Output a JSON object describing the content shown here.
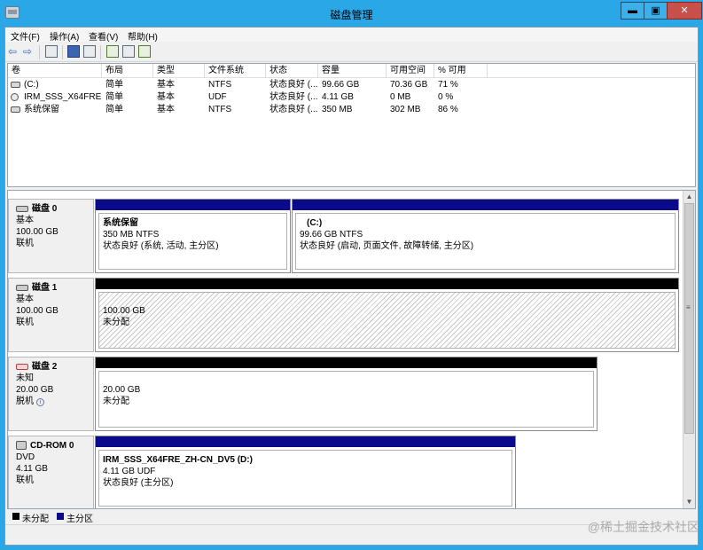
{
  "window": {
    "title": "磁盘管理",
    "min_glyph": "▬",
    "max_glyph": "▣",
    "close_glyph": "✕"
  },
  "menu": [
    {
      "label": "文件(F)"
    },
    {
      "label": "操作(A)"
    },
    {
      "label": "查看(V)"
    },
    {
      "label": "帮助(H)"
    }
  ],
  "toolbar": {
    "back_glyph": "⇦",
    "forward_glyph": "⇨"
  },
  "volume_table": {
    "headers": [
      "卷",
      "布局",
      "类型",
      "文件系统",
      "状态",
      "容量",
      "可用空间",
      "% 可用"
    ],
    "rows": [
      {
        "volume": "(C:)",
        "layout": "简单",
        "type": "基本",
        "fs": "NTFS",
        "status": "状态良好 (...",
        "capacity": "99.66 GB",
        "free": "70.36 GB",
        "pct": "71 %",
        "icon": "drive-icon"
      },
      {
        "volume": "IRM_SSS_X64FRE...",
        "layout": "简单",
        "type": "基本",
        "fs": "UDF",
        "status": "状态良好 (...",
        "capacity": "4.11 GB",
        "free": "0 MB",
        "pct": "0 %",
        "icon": "cdrom-icon"
      },
      {
        "volume": "系统保留",
        "layout": "简单",
        "type": "基本",
        "fs": "NTFS",
        "status": "状态良好 (...",
        "capacity": "350 MB",
        "free": "302 MB",
        "pct": "86 %",
        "icon": "drive-icon"
      }
    ]
  },
  "disks": [
    {
      "name": "磁盘 0",
      "kind": "基本",
      "size": "100.00 GB",
      "state": "联机",
      "partitions": [
        {
          "name": "系统保留",
          "detail": "350 MB NTFS",
          "status": "状态良好 (系统, 活动, 主分区)",
          "bar": "blue"
        },
        {
          "name": "(C:)",
          "detail": "99.66 GB NTFS",
          "status": "状态良好 (启动, 页面文件, 故障转储, 主分区)",
          "bar": "blue"
        }
      ]
    },
    {
      "name": "磁盘 1",
      "kind": "基本",
      "size": "100.00 GB",
      "state": "联机",
      "partitions": [
        {
          "name": "",
          "detail": "100.00 GB",
          "status": "未分配",
          "bar": "black"
        }
      ]
    },
    {
      "name": "磁盘 2",
      "kind": "未知",
      "size": "20.00 GB",
      "state": "脱机",
      "partitions": [
        {
          "name": "",
          "detail": "20.00 GB",
          "status": "未分配",
          "bar": "black"
        }
      ]
    },
    {
      "name": "CD-ROM 0",
      "kind": "DVD",
      "size": "4.11 GB",
      "state": "联机",
      "partitions": [
        {
          "name": "IRM_SSS_X64FRE_ZH-CN_DV5  (D:)",
          "detail": "4.11 GB UDF",
          "status": "状态良好 (主分区)",
          "bar": "blue"
        }
      ]
    }
  ],
  "legend": {
    "unallocated": "未分配",
    "primary": "主分区"
  },
  "watermark": "@稀土掘金技术社区",
  "colors": {
    "primary_bar": "#0a0a8a",
    "unallocated_bar": "#000000",
    "title_bar": "#2aa7e6"
  }
}
